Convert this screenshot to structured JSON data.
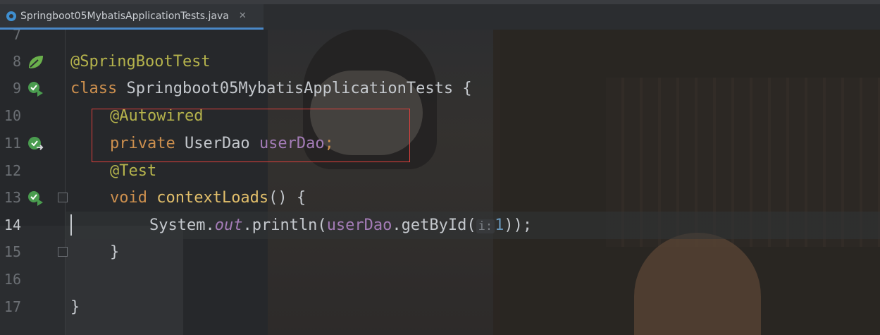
{
  "tab": {
    "filename": "Springboot05MybatisApplicationTests.java",
    "close_glyph": "✕"
  },
  "editor": {
    "lines": [
      {
        "number": "7"
      },
      {
        "number": "8",
        "gutter_icon": "spring-bean-icon"
      },
      {
        "number": "9",
        "gutter_icon": "run-test-icon"
      },
      {
        "number": "10"
      },
      {
        "number": "11",
        "gutter_icon": "navigate-bean-icon"
      },
      {
        "number": "12"
      },
      {
        "number": "13",
        "gutter_icon": "run-test-icon"
      },
      {
        "number": "14",
        "current": true
      },
      {
        "number": "15"
      },
      {
        "number": "16"
      },
      {
        "number": "17"
      }
    ],
    "code": {
      "l8_annotation": "@SpringBootTest",
      "l9_kw": "class",
      "l9_name": " Springboot05MybatisApplicationTests ",
      "l9_brace": "{",
      "l10_annotation": "@Autowired",
      "l11_kw": "private",
      "l11_type": " UserDao ",
      "l11_field": "userDao",
      "l11_semi": ";",
      "l12_annotation": "@Test",
      "l13_kw": "void",
      "l13_method": " contextLoads",
      "l13_rest": "() {",
      "l14_sys": "System.",
      "l14_out": "out",
      "l14_println": ".println(",
      "l14_field": "userDao",
      "l14_call": ".getById(",
      "l14_hint": "i:",
      "l14_num": "1",
      "l14_end": "));",
      "l15_brace": "}",
      "l17_brace": "}"
    }
  },
  "colors": {
    "keyword": "#cc8f4e",
    "annotation": "#b5b34c",
    "field": "#a47cb7",
    "number": "#6897bb",
    "highlight_box": "#e0403c",
    "tab_underline": "#4a88c7"
  }
}
